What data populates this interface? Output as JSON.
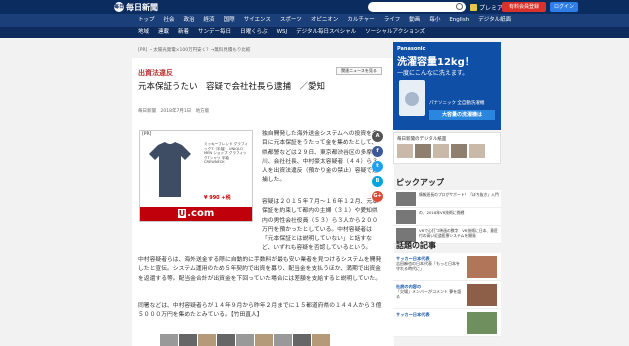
{
  "header": {
    "logo_mark": "毎日",
    "logo_text": "毎日新聞",
    "premier_label": "プレミア",
    "subscribe_label": "有料会員登録",
    "login_label": "ログイン"
  },
  "nav_primary": [
    "トップ",
    "社会",
    "政治",
    "経済",
    "国際",
    "サイエンス",
    "スポーツ",
    "オピニオン",
    "カルチャー",
    "ライフ",
    "動画",
    "毎小",
    "English",
    "デジタル紙面"
  ],
  "nav_secondary": [
    "地域",
    "連載",
    "新着",
    "サンデー毎日",
    "日曜くらぶ",
    "WSJ",
    "デジタル毎日スペシャル",
    "ソーシャルアクションズ"
  ],
  "ad_line": "[PR] ・太陽光発電×100万円安く？→無料見積もり比較",
  "article": {
    "category": "出資法違反",
    "related_label": "関連ニュースを見る",
    "headline": "元本保証うたい　容疑で会社社長ら逮捕　／愛知",
    "date": "毎日新聞　2018年7月1日　地方版",
    "p1": "独自開発した海外送金システムへの投資を名目に元本保証をうたって金を集めたとして、県都警などは２９日、東京都渋谷区の多摩川、会社社長、中村豪太容疑者（４４）ら３人を出資法違反（預かり金の禁止）容疑で逮捕した。",
    "p2": "容疑は２０１５年７月〜１６年１２月、元本保証を約束して都内の主婦（３１）や愛知県内の男性会社役員（５３）ら３人から２００万円を預かったとしている。中村容疑者は「元本保証とは説明していない」と話すなど、いずれも容疑を否認しているという。",
    "p3": "中村容疑者らは、海外送金する際に自動的に手数料が最も安い業者を見つけるシステムを開発したと宣伝。システム運用のため５年契約で出資を募り、配当金を支払うほか、満期で出資金を返還する等。配当金合計が出資金を下回っていた場合には差額を支給すると説明していた。",
    "p4": "同署などは、中村容疑者らが１４年９月から昨年２月までに１５都道府県の１４４人から３億５０００万円を集めたとみている。【竹田直人】",
    "share_labels": [
      "A",
      "f",
      "t",
      "B",
      "G+"
    ]
  },
  "pr_ad": {
    "tag": "[PR]",
    "copy": "ミッキーフレンド グラフィックT（半袖） UNIQLO MEN ショップ グラフィックTシャツ 半袖 CREWNECK",
    "price": "¥ 990 +税",
    "banner_mark": "U",
    "banner_text": ".com"
  },
  "sidebar": {
    "ad": {
      "brand": "Panasonic",
      "title": "洗濯容量12kg！",
      "sub": "一度にこんなに洗えます。",
      "model": "パナソニック 全自動洗濯機",
      "button": "大容量の洗濯機は"
    },
    "grid_title": "毎日新聞のデジタル紙面",
    "pickup_title": "ピックアップ",
    "pickup": [
      "情報班長のプロがサポート！「ぼち抜き」入門",
      "の、2018年VR技術に挑戦",
      "VRで心打つ映画の数字　VR技術に日本、意匠付の高い近道医療システムを開発"
    ],
    "topic_title": "話題の記事",
    "topics": [
      {
        "head": "サッカー日本代表",
        "body": "吉田麻也の日本代表「もっと日本を守れる時代に」"
      },
      {
        "head": "社説の内容の",
        "body": "「欠場」メンバーがコメント 夢を語る"
      },
      {
        "head": "サッカー日本代表",
        "body": ""
      }
    ]
  },
  "colors": {
    "nav_bg": "#1a3f79",
    "topbar_bg": "#0b2c5e",
    "accent_red": "#d9322c",
    "login_blue": "#2e7ee5"
  }
}
